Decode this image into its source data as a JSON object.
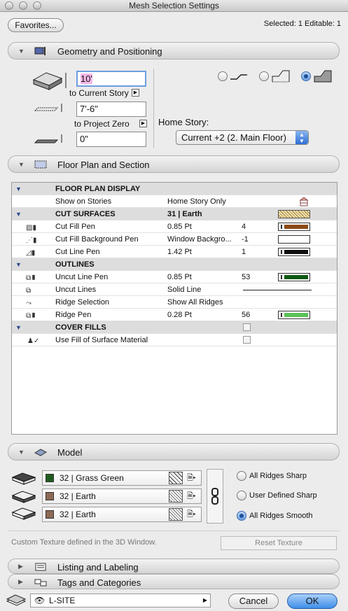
{
  "window": {
    "title": "Mesh Selection Settings"
  },
  "header": {
    "favorites_label": "Favorites...",
    "status": "Selected: 1 Editable: 1"
  },
  "geometry": {
    "section_label": "Geometry and Positioning",
    "offset_value": "10'",
    "offset_ref_label": "to Current Story",
    "project_zero_value": "7'-6\"",
    "project_zero_label": "to Project Zero",
    "thickness_value": "0\"",
    "home_story_label": "Home Story:",
    "home_story_value": "Current +2 (2. Main Floor)"
  },
  "floor_plan": {
    "section_label": "Floor Plan and Section",
    "rows": [
      {
        "type": "header",
        "name": "FLOOR PLAN DISPLAY",
        "value": "",
        "num": ""
      },
      {
        "type": "item",
        "name": "Show on Stories",
        "value": "Home Story Only",
        "num": ""
      },
      {
        "type": "header",
        "name": "CUT SURFACES",
        "value": "31 | Earth",
        "num": ""
      },
      {
        "type": "item",
        "name": "Cut Fill Pen",
        "value": "0.85 Pt",
        "num": "4"
      },
      {
        "type": "item",
        "name": "Cut Fill Background Pen",
        "value": "Window Backgro...",
        "num": "-1"
      },
      {
        "type": "item",
        "name": "Cut Line Pen",
        "value": "1.42 Pt",
        "num": "1"
      },
      {
        "type": "header",
        "name": "OUTLINES",
        "value": "",
        "num": ""
      },
      {
        "type": "item",
        "name": "Uncut Line Pen",
        "value": "0.85 Pt",
        "num": "53"
      },
      {
        "type": "item",
        "name": "Uncut Lines",
        "value": "Solid Line",
        "num": ""
      },
      {
        "type": "item",
        "name": "Ridge Selection",
        "value": "Show All Ridges",
        "num": ""
      },
      {
        "type": "item",
        "name": "Ridge Pen",
        "value": "0.28 Pt",
        "num": "56"
      },
      {
        "type": "header",
        "name": "COVER FILLS",
        "value": "",
        "num": ""
      },
      {
        "type": "item",
        "name": "Use Fill of Surface Material",
        "value": "",
        "num": ""
      }
    ],
    "colors": {
      "cut_fill_pen": "#8b4a14",
      "cut_line_pen": "#111111",
      "uncut_line_pen": "#0f5a12",
      "ridge_pen": "#5bc45a"
    }
  },
  "model": {
    "section_label": "Model",
    "surfaces": [
      {
        "label": "32 | Grass Green",
        "color": "#1f5c20"
      },
      {
        "label": "32 | Earth",
        "color": "#8d6a55"
      },
      {
        "label": "32 | Earth",
        "color": "#8d6a55"
      }
    ],
    "ridge_options": [
      "All Ridges Sharp",
      "User Defined Sharp",
      "All Ridges Smooth"
    ],
    "selected_ridge": "All Ridges Smooth",
    "custom_texture_note": "Custom Texture defined in the 3D Window.",
    "reset_texture_label": "Reset Texture"
  },
  "listing": {
    "section_label": "Listing and Labeling"
  },
  "tags": {
    "section_label": "Tags and Categories"
  },
  "footer": {
    "layer_value": "L-SITE",
    "cancel_label": "Cancel",
    "ok_label": "OK"
  }
}
